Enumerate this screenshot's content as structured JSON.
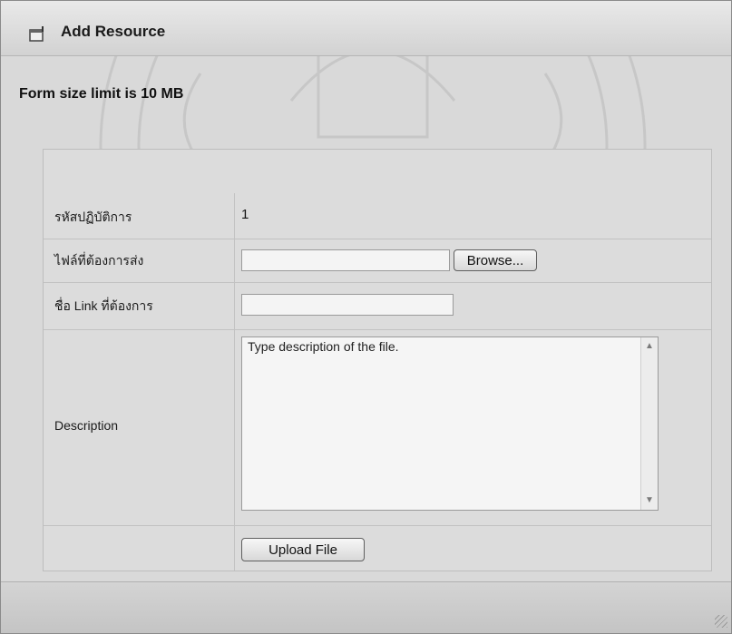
{
  "window": {
    "title": "Add Resource"
  },
  "notice": {
    "limit_text": "Form size limit is 10 MB"
  },
  "form": {
    "rows": [
      {
        "label": "รหัสปฏิบัติการ",
        "value": "1"
      },
      {
        "label": "ไฟล์ที่ต้องการส่ง",
        "value": ""
      },
      {
        "label": "ชื่อ Link ที่ต้องการ",
        "value": ""
      },
      {
        "label": "Description",
        "value": "Type description of the file."
      }
    ],
    "browse_label": "Browse...",
    "upload_label": "Upload File"
  },
  "icons": {
    "title": "form-icon",
    "scroll_up": "scroll-up-icon",
    "scroll_down": "scroll-down-icon",
    "grip": "resize-grip-icon"
  },
  "colors": {
    "window_bg": "#d9d9d9",
    "panel_bg": "#dcdcdc"
  }
}
